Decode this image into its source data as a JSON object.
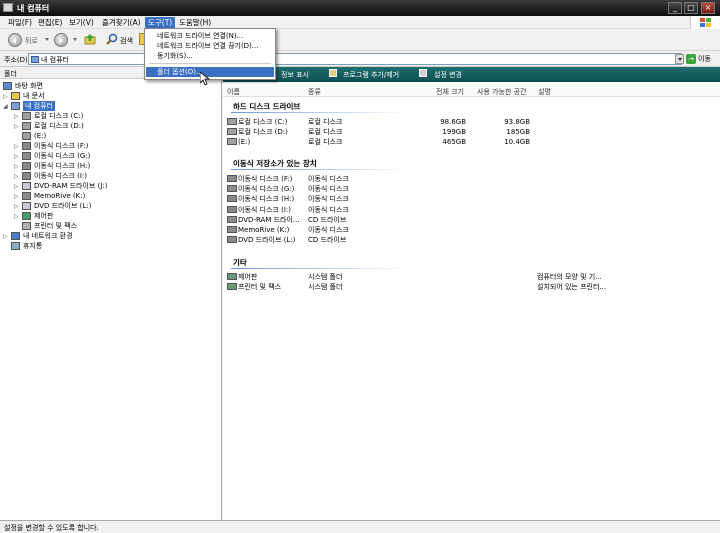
{
  "window": {
    "title": "내 컴퓨터"
  },
  "menubar": [
    "파일(F)",
    "편집(E)",
    "보기(V)",
    "즐겨찾기(A)",
    "도구(T)",
    "도움말(H)"
  ],
  "toolbar": {
    "back_label": "뒤로",
    "search_label": "검색"
  },
  "address": {
    "label": "주소(D)",
    "value": "내 컴퓨터",
    "go_label": "이동"
  },
  "folder_pane": {
    "title": "폴더",
    "tree": [
      {
        "label": "바탕 화면",
        "icon": "desktop-icon"
      },
      {
        "label": "내 문서",
        "icon": "documents-icon"
      },
      {
        "label": "내 컴퓨터",
        "icon": "computer-icon"
      },
      {
        "label": "로컬 디스크 (C:)",
        "icon": "disk-icon"
      },
      {
        "label": "로컬 디스크 (D:)",
        "icon": "disk-icon"
      },
      {
        "label": "(E:)",
        "icon": "disk-icon"
      },
      {
        "label": "이동식 디스크 (F:)",
        "icon": "removable-disk-icon"
      },
      {
        "label": "이동식 디스크 (G:)",
        "icon": "removable-disk-icon"
      },
      {
        "label": "이동식 디스크 (H:)",
        "icon": "removable-disk-icon"
      },
      {
        "label": "이동식 디스크 (I:)",
        "icon": "removable-disk-icon"
      },
      {
        "label": "DVD-RAM 드라이브 (J:)",
        "icon": "dvd-icon"
      },
      {
        "label": "MemoRive (K:)",
        "icon": "removable-disk-icon"
      },
      {
        "label": "DVD 드라이브 (L:)",
        "icon": "dvd-icon"
      },
      {
        "label": "제어판",
        "icon": "control-panel-icon"
      },
      {
        "label": "프린터 및 팩스",
        "icon": "printer-icon"
      },
      {
        "label": "내 네트워크 환경",
        "icon": "network-icon"
      },
      {
        "label": "휴지통",
        "icon": "recycle-bin-icon"
      }
    ]
  },
  "task_strip": [
    "정보 표시",
    "프로그램 추가/제거",
    "설정 변경"
  ],
  "columns": [
    "이름",
    "종류",
    "전체 크기",
    "사용 가능한 공간",
    "설명"
  ],
  "groups": [
    {
      "title": "하드 디스크 드라이브",
      "rows": [
        {
          "name": "로컬 디스크 (C:)",
          "type": "로컬 디스크",
          "total": "98.6GB",
          "free": "93.8GB",
          "desc": ""
        },
        {
          "name": "로컬 디스크 (D:)",
          "type": "로컬 디스크",
          "total": "199GB",
          "free": "185GB",
          "desc": ""
        },
        {
          "name": "(E:)",
          "type": "로컬 디스크",
          "total": "465GB",
          "free": "10.4GB",
          "desc": ""
        }
      ]
    },
    {
      "title": "이동식 저장소가 있는 장치",
      "rows": [
        {
          "name": "이동식 디스크 (F:)",
          "type": "이동식 디스크",
          "total": "",
          "free": "",
          "desc": ""
        },
        {
          "name": "이동식 디스크 (G:)",
          "type": "이동식 디스크",
          "total": "",
          "free": "",
          "desc": ""
        },
        {
          "name": "이동식 디스크 (H:)",
          "type": "이동식 디스크",
          "total": "",
          "free": "",
          "desc": ""
        },
        {
          "name": "이동식 디스크 (I:)",
          "type": "이동식 디스크",
          "total": "",
          "free": "",
          "desc": ""
        },
        {
          "name": "DVD-RAM 드라이...",
          "type": "CD 드라이브",
          "total": "",
          "free": "",
          "desc": ""
        },
        {
          "name": "MemoRive (K:)",
          "type": "이동식 디스크",
          "total": "",
          "free": "",
          "desc": ""
        },
        {
          "name": "DVD 드라이브 (L:)",
          "type": "CD 드라이브",
          "total": "",
          "free": "",
          "desc": ""
        }
      ]
    },
    {
      "title": "기타",
      "rows": [
        {
          "name": "제어판",
          "type": "시스템 폴더",
          "total": "",
          "free": "",
          "desc": "컴퓨터의 모양 및 기..."
        },
        {
          "name": "프린터 및 팩스",
          "type": "시스템 폴더",
          "total": "",
          "free": "",
          "desc": "설치되어 있는 프린터..."
        }
      ]
    }
  ],
  "dropdown": [
    "네트워크 드라이브 연결(N)...",
    "네트워크 드라이브 연결 끊기(D)...",
    "동기화(S)...",
    "폴더 옵션(O)..."
  ],
  "status": "설정을 변경할 수 있도록 합니다.",
  "colors": {
    "highlight": "#3a6fc4",
    "strip": "#1f6e6e"
  }
}
